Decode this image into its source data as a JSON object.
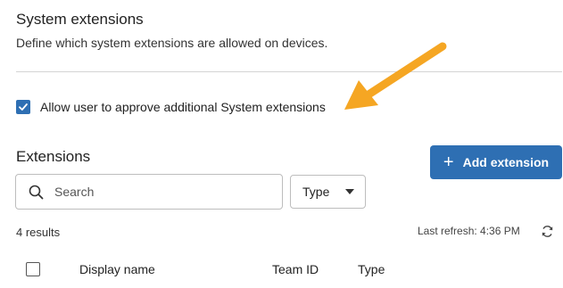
{
  "system_extensions": {
    "title": "System extensions",
    "description": "Define which system extensions are allowed on devices.",
    "allow_user_approve": {
      "label": "Allow user to approve additional System extensions",
      "checked": true
    }
  },
  "extensions": {
    "title": "Extensions",
    "add_button_label": "Add extension",
    "search_placeholder": "Search",
    "type_filter_label": "Type",
    "results_count": "4 results",
    "last_refresh": "Last refresh: 4:36 PM",
    "table": {
      "columns": [
        "Display name",
        "Team ID",
        "Type"
      ]
    }
  },
  "colors": {
    "accent": "#2e6fb3",
    "arrow": "#f5a623"
  },
  "icons": [
    "check-icon",
    "plus-icon",
    "search-icon",
    "caret-down-icon",
    "refresh-icon",
    "annotation-arrow"
  ]
}
